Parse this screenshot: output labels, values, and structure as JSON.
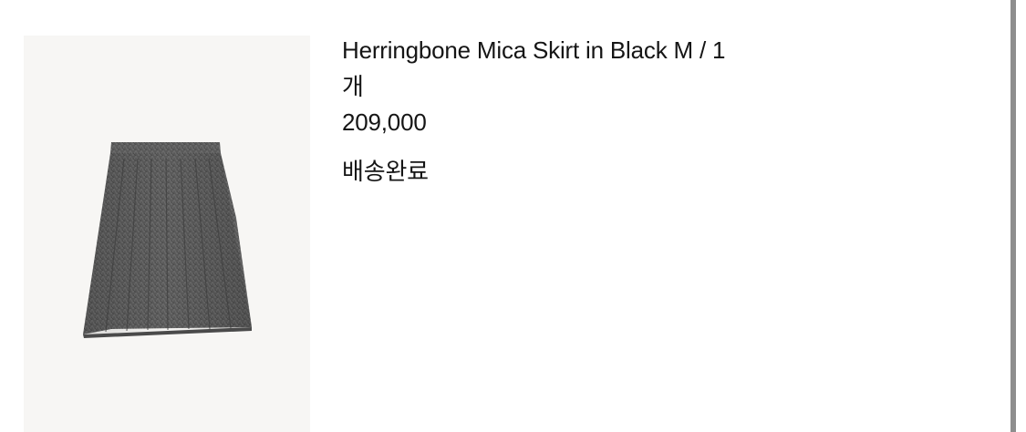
{
  "item": {
    "name": "Herringbone Mica Skirt in Black M / 1",
    "quantity_unit": "개",
    "price": "209,000",
    "status": "배송완료"
  },
  "image": {
    "description_icon": "skirt-product-image",
    "background_color": "#f7f6f4",
    "fabric_color": "#555555"
  }
}
